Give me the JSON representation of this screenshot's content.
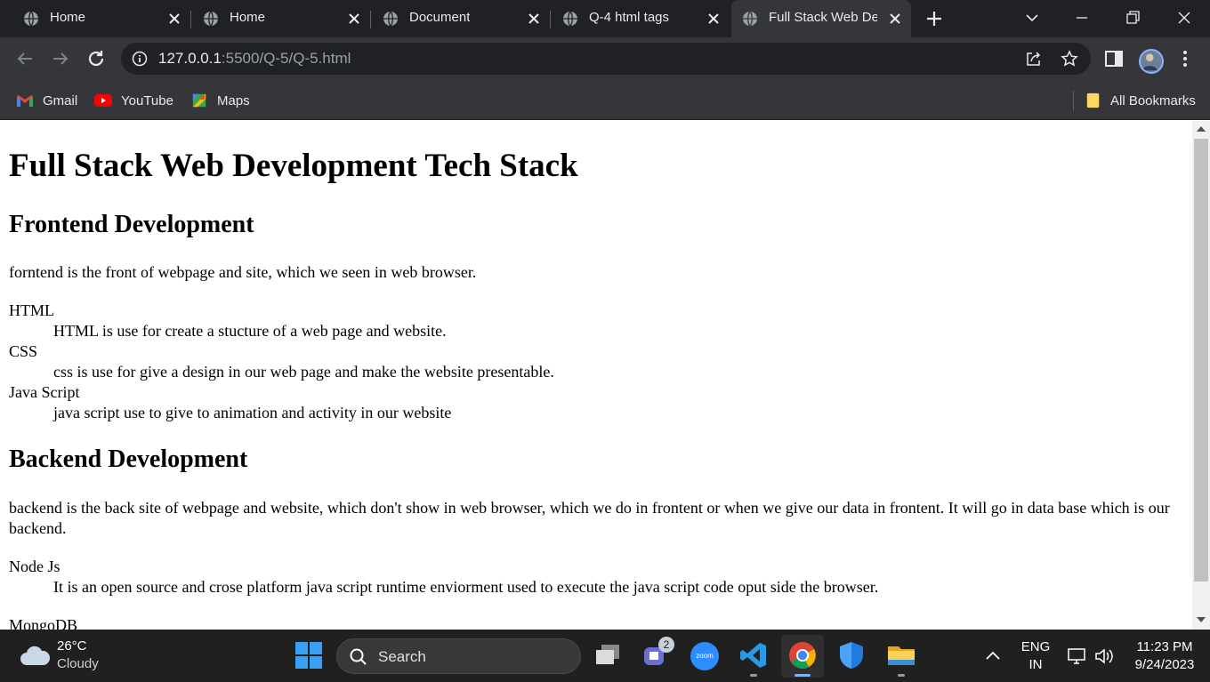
{
  "tabs": [
    {
      "title": "Home"
    },
    {
      "title": "Home"
    },
    {
      "title": "Document"
    },
    {
      "title": "Q-4 html tags"
    },
    {
      "title": "Full Stack Web Dev"
    }
  ],
  "address_bar": {
    "host": "127.0.0.1",
    "path": ":5500/Q-5/Q-5.html"
  },
  "bookmarks": {
    "items": [
      {
        "label": "Gmail"
      },
      {
        "label": "YouTube"
      },
      {
        "label": "Maps"
      }
    ],
    "all_label": "All Bookmarks"
  },
  "page": {
    "title": "Full Stack Web Development Tech Stack",
    "frontend": {
      "heading": "Frontend Development",
      "intro": "forntend is the front of webpage and site, which we seen in web browser.",
      "items": [
        {
          "term": "HTML",
          "desc": "HTML is use for create a stucture of a web page and website."
        },
        {
          "term": "CSS",
          "desc": "css is use for give a design in our web page and make the website presentable."
        },
        {
          "term": "Java Script",
          "desc": "java script use to give to animation and activity in our website"
        }
      ]
    },
    "backend": {
      "heading": "Backend Development",
      "intro": "backend is the back site of webpage and website, which don't show in web browser, which we do in frontent or when we give our data in frontent. It will go in data base which is our backend.",
      "items": [
        {
          "term": "Node Js",
          "desc": "It is an open source and crose platform java script runtime enviorment used to execute the java script code oput side the browser."
        },
        {
          "term": "MongoDB"
        }
      ]
    }
  },
  "taskbar": {
    "weather": {
      "temp": "26°C",
      "desc": "Cloudy"
    },
    "search_placeholder": "Search",
    "chat_badge": "2",
    "zoom_label": "zoom",
    "lang": {
      "line1": "ENG",
      "line2": "IN"
    },
    "clock": {
      "time": "11:23 PM",
      "date": "9/24/2023"
    }
  },
  "colors": {
    "tabstrip": "#202124",
    "toolbar": "#35363a",
    "taskbar": "#202020",
    "page_bg": "#ffffff"
  }
}
